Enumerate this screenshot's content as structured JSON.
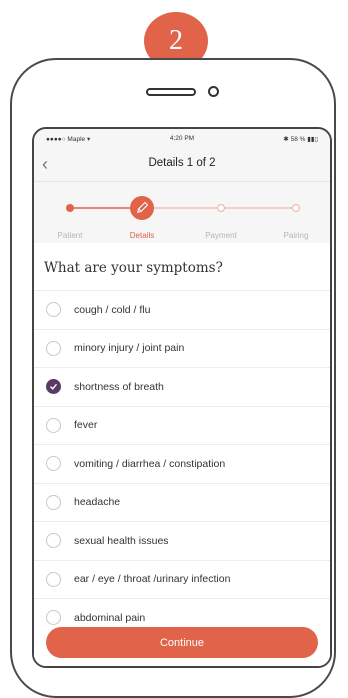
{
  "badge": {
    "number": "2",
    "color": "#e0634a"
  },
  "status_bar": {
    "carrier": "●●●●○ Maple ▾",
    "time": "4:20 PM",
    "battery": "✱ 58 % ▮▮▯"
  },
  "nav": {
    "back": "‹",
    "title": "Details 1 of 2"
  },
  "stepper": {
    "accent": "#e0634a",
    "steps": [
      {
        "label": "Patient",
        "state": "done"
      },
      {
        "label": "Details",
        "state": "active",
        "icon": "pencil-icon"
      },
      {
        "label": "Payment",
        "state": "pending"
      },
      {
        "label": "Pairing",
        "state": "pending"
      }
    ]
  },
  "question": "What are your symptoms?",
  "options": [
    {
      "label": "cough / cold / flu",
      "checked": false
    },
    {
      "label": "minory injury / joint pain",
      "checked": false
    },
    {
      "label": "shortness of breath",
      "checked": true
    },
    {
      "label": "fever",
      "checked": false
    },
    {
      "label": "vomiting / diarrhea / constipation",
      "checked": false
    },
    {
      "label": "headache",
      "checked": false
    },
    {
      "label": "sexual health issues",
      "checked": false
    },
    {
      "label": "ear / eye / throat /urinary infection",
      "checked": false
    },
    {
      "label": "abdominal pain",
      "checked": false
    }
  ],
  "continue_label": "Continue",
  "checked_color": "#5a3b66"
}
